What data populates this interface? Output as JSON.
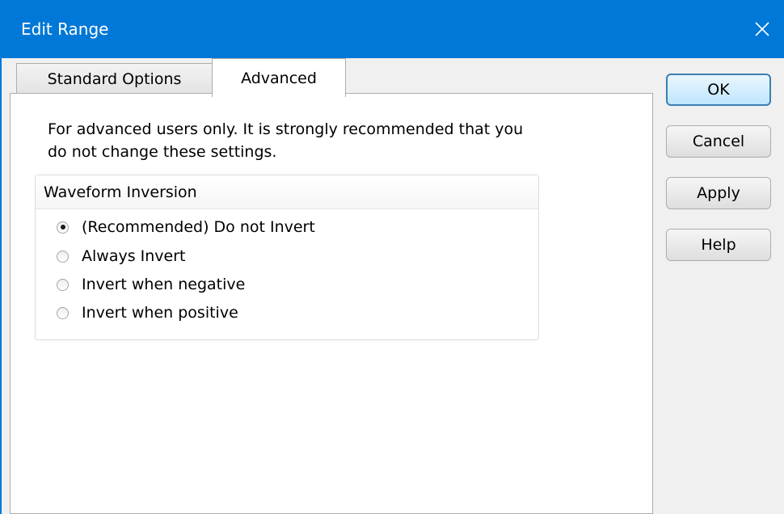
{
  "window": {
    "title": "Edit Range"
  },
  "tabs": [
    {
      "label": "Standard Options",
      "active": false
    },
    {
      "label": "Advanced",
      "active": true
    }
  ],
  "advanced": {
    "description": "For advanced users only. It is strongly recommended that you do not change these settings.",
    "group_title": "Waveform Inversion",
    "options": [
      {
        "label": "(Recommended) Do not Invert",
        "selected": true
      },
      {
        "label": "Always Invert",
        "selected": false
      },
      {
        "label": "Invert when negative",
        "selected": false
      },
      {
        "label": "Invert when positive",
        "selected": false
      }
    ]
  },
  "buttons": {
    "ok": "OK",
    "cancel": "Cancel",
    "apply": "Apply",
    "help": "Help"
  },
  "colors": {
    "titlebar": "#0078d7",
    "title_text": "#ffffff"
  },
  "icons": {
    "close": "close-icon"
  }
}
